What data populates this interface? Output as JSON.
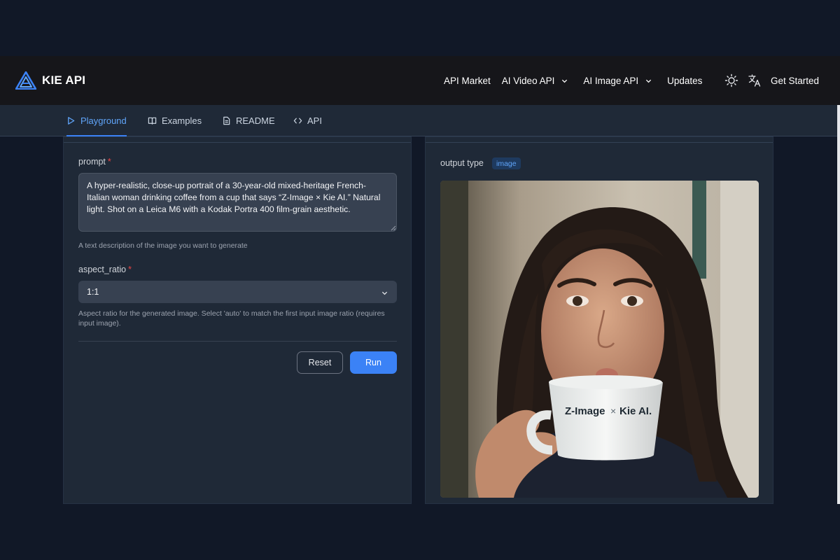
{
  "brand": {
    "name": "KIE API",
    "logo": "kie-logo-icon"
  },
  "nav": {
    "links": [
      {
        "label": "API Market",
        "dropdown": false
      },
      {
        "label": "AI Video API",
        "dropdown": true
      },
      {
        "label": "AI Image API",
        "dropdown": true
      },
      {
        "label": "Updates",
        "dropdown": false
      }
    ],
    "icons": [
      "sun-icon",
      "translate-icon"
    ],
    "get_started": "Get Started"
  },
  "tabs": [
    {
      "label": "Playground",
      "icon": "play-icon",
      "active": true
    },
    {
      "label": "Examples",
      "icon": "book-icon",
      "active": false
    },
    {
      "label": "README",
      "icon": "file-icon",
      "active": false
    },
    {
      "label": "API",
      "icon": "code-icon",
      "active": false
    }
  ],
  "form": {
    "prompt": {
      "label": "prompt",
      "required_mark": "*",
      "value": "A hyper-realistic, close-up portrait of a 30-year-old mixed-heritage French-Italian woman drinking coffee from a cup that says “Z-Image × Kie AI.” Natural light. Shot on a Leica M6 with a Kodak Portra 400 film-grain aesthetic.",
      "help": "A text description of the image you want to generate"
    },
    "aspect_ratio": {
      "label": "aspect_ratio",
      "required_mark": "*",
      "value": "1:1",
      "help": "Aspect ratio for the generated image. Select 'auto' to match the first input image ratio (requires input image)."
    },
    "reset_label": "Reset",
    "run_label": "Run"
  },
  "output": {
    "label": "output type",
    "type_badge": "image",
    "cup_text_left": "Z-Image",
    "cup_text_x": "×",
    "cup_text_right": "Kie AI."
  },
  "colors": {
    "background": "#111827",
    "navbar": "#16161a",
    "panel": "#1f2937",
    "accent": "#3b82f6",
    "active_tab": "#60a5fa"
  }
}
